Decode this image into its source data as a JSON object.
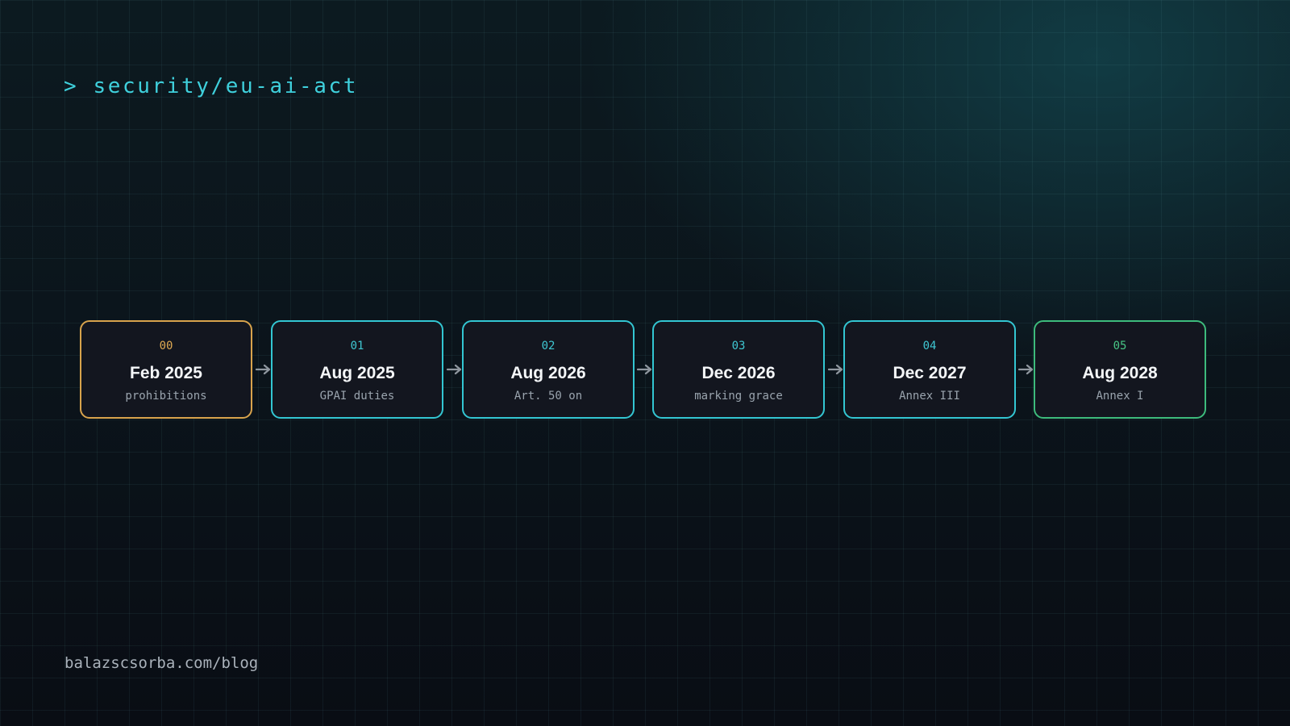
{
  "header": {
    "prompt": "> security/eu-ai-act"
  },
  "timeline": {
    "stages": [
      {
        "index": "00",
        "date": "Feb 2025",
        "label": "prohibitions",
        "accent": "#d8a34c"
      },
      {
        "index": "01",
        "date": "Aug 2025",
        "label": "GPAI duties",
        "accent": "#33c6d2"
      },
      {
        "index": "02",
        "date": "Aug 2026",
        "label": "Art. 50 on",
        "accent": "#33c6d2"
      },
      {
        "index": "03",
        "date": "Dec 2026",
        "label": "marking grace",
        "accent": "#33c6d2"
      },
      {
        "index": "04",
        "date": "Dec 2027",
        "label": "Annex III",
        "accent": "#33c6d2"
      },
      {
        "index": "05",
        "date": "Aug 2028",
        "label": "Annex I",
        "accent": "#3dbb7c"
      }
    ]
  },
  "footer": {
    "url": "balazscsorba.com/blog"
  },
  "icons": {
    "connector": "arrow-right-icon"
  },
  "colors": {
    "prompt": "#3fd0dc",
    "box_background": "#13161f",
    "arrow": "#8f979f"
  }
}
